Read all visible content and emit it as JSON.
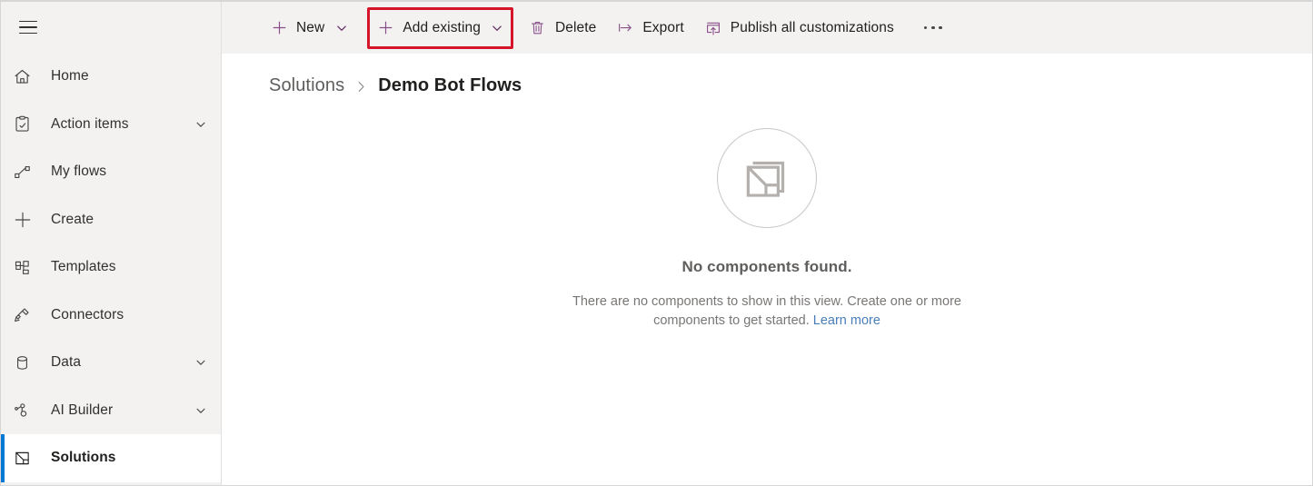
{
  "sidebar": {
    "menu_button": "menu-icon",
    "items": [
      {
        "label": "Home",
        "icon": "home-icon",
        "chevron": false,
        "active": false
      },
      {
        "label": "Action items",
        "icon": "clipboard-check-icon",
        "chevron": true,
        "active": false
      },
      {
        "label": "My flows",
        "icon": "flow-icon",
        "chevron": false,
        "active": false
      },
      {
        "label": "Create",
        "icon": "plus-icon",
        "chevron": false,
        "active": false
      },
      {
        "label": "Templates",
        "icon": "templates-icon",
        "chevron": false,
        "active": false
      },
      {
        "label": "Connectors",
        "icon": "connectors-icon",
        "chevron": false,
        "active": false
      },
      {
        "label": "Data",
        "icon": "database-icon",
        "chevron": true,
        "active": false
      },
      {
        "label": "AI Builder",
        "icon": "ai-builder-icon",
        "chevron": true,
        "active": false
      },
      {
        "label": "Solutions",
        "icon": "solutions-icon",
        "chevron": false,
        "active": true
      }
    ]
  },
  "toolbar": {
    "new_label": "New",
    "add_existing_label": "Add existing",
    "delete_label": "Delete",
    "export_label": "Export",
    "publish_label": "Publish all customizations",
    "overflow_label": "More commands",
    "highlight_color": "#d6152b",
    "icon_color": "#8a4f8a"
  },
  "breadcrumb": {
    "parent": "Solutions",
    "separator": "›",
    "current": "Demo Bot Flows"
  },
  "empty_state": {
    "title": "No components found.",
    "description": "There are no components to show in this view. Create one or more components to get started.",
    "link_text": "Learn more",
    "illustration": "empty-folder-icon"
  },
  "colors": {
    "accent": "#0078d4",
    "sidebar_bg": "#f3f2f1",
    "toolbar_bg": "#f3f2f1",
    "link": "#4a7ebb"
  }
}
